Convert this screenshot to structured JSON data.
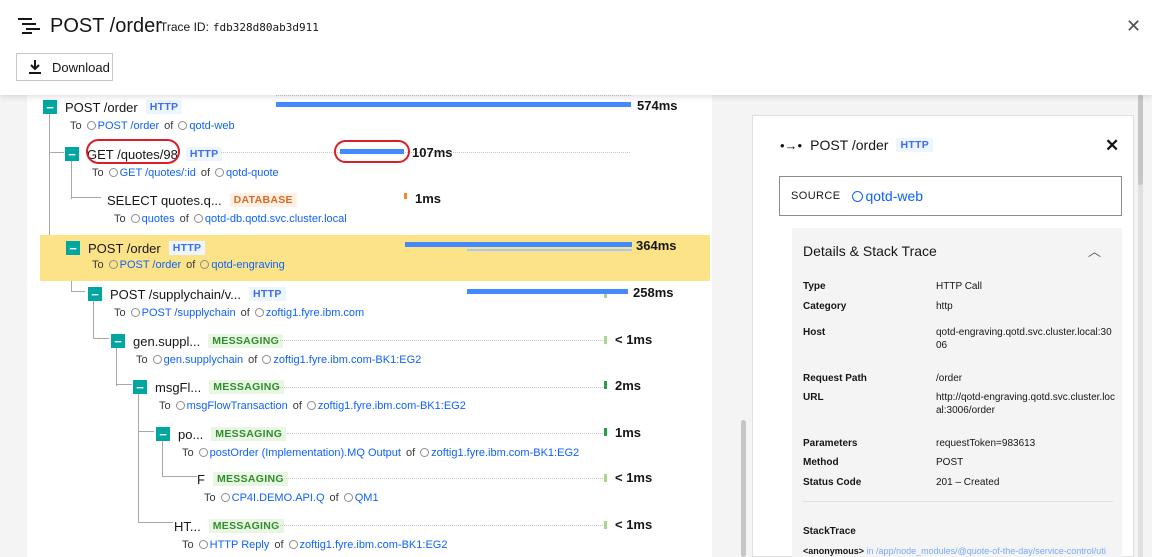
{
  "header": {
    "title": "POST /order",
    "trace_label": "Trace ID:",
    "trace_id": "fdb328d80ab3d911",
    "download_label": "Download"
  },
  "spans": [
    {
      "name": "POST /order",
      "badge": "HTTP",
      "to_label": "To",
      "endpoint": "POST /order",
      "of_label": "of",
      "service": "qotd-web",
      "duration": "574ms"
    },
    {
      "name": "GET /quotes/98",
      "badge": "HTTP",
      "to_label": "To",
      "endpoint": "GET /quotes/:id",
      "of_label": "of",
      "service": "qotd-quote",
      "duration": "107ms"
    },
    {
      "name": "SELECT quotes.q...",
      "badge": "DATABASE",
      "to_label": "To",
      "endpoint": "quotes",
      "of_label": "of",
      "service": "qotd-db.qotd.svc.cluster.local",
      "duration": "1ms"
    },
    {
      "name": "POST /order",
      "badge": "HTTP",
      "to_label": "To",
      "endpoint": "POST /order",
      "of_label": "of",
      "service": "qotd-engraving",
      "duration": "364ms"
    },
    {
      "name": "POST /supplychain/v...",
      "badge": "HTTP",
      "to_label": "To",
      "endpoint": "POST /supplychain",
      "of_label": "of",
      "service": "zoftig1.fyre.ibm.com",
      "duration": "258ms"
    },
    {
      "name": "gen.suppl...",
      "badge": "MESSAGING",
      "to_label": "To",
      "endpoint": "gen.supplychain",
      "of_label": "of",
      "service": "zoftig1.fyre.ibm.com-BK1:EG2",
      "duration": "< 1ms"
    },
    {
      "name": "msgFl...",
      "badge": "MESSAGING",
      "to_label": "To",
      "endpoint": "msgFlowTransaction",
      "of_label": "of",
      "service": "zoftig1.fyre.ibm.com-BK1:EG2",
      "duration": "2ms"
    },
    {
      "name": "po...",
      "badge": "MESSAGING",
      "to_label": "To",
      "endpoint": "postOrder (Implementation).MQ Output",
      "of_label": "of",
      "service": "zoftig1.fyre.ibm.com-BK1:EG2",
      "duration": "1ms"
    },
    {
      "name": "F",
      "badge": "MESSAGING",
      "to_label": "To",
      "endpoint": "CP4I.DEMO.API.Q",
      "of_label": "of",
      "service": "QM1",
      "duration": "< 1ms"
    },
    {
      "name": "HT...",
      "badge": "MESSAGING",
      "to_label": "To",
      "endpoint": "HTTP Reply",
      "of_label": "of",
      "service": "zoftig1.fyre.ibm.com-BK1:EG2",
      "duration": "< 1ms"
    }
  ],
  "detail": {
    "title": "POST /order",
    "badge": "HTTP",
    "source_label": "SOURCE",
    "source_value": "qotd-web",
    "section_title": "Details & Stack Trace",
    "fields": [
      {
        "key": "Type",
        "value": "HTTP Call"
      },
      {
        "key": "Category",
        "value": "http"
      },
      {
        "key": "Host",
        "value": "qotd-engraving.qotd.svc.cluster.local:3006"
      },
      {
        "key": "Request Path",
        "value": "/order"
      },
      {
        "key": "URL",
        "value": "http://qotd-engraving.qotd.svc.cluster.local:3006/order"
      },
      {
        "key": "Parameters",
        "value": "requestToken=983613"
      },
      {
        "key": "Method",
        "value": "POST"
      },
      {
        "key": "Status Code",
        "value": "201 – Created"
      }
    ],
    "stacktrace_label": "StackTrace",
    "stacktrace_fn": "<anonymous>",
    "stacktrace_path": "in /app/node_modules/@quote-of-the-day/service-control/uti"
  },
  "colors": {
    "accent": "#00a6a0",
    "highlight": "#fce388",
    "bar": "#4589ff",
    "link": "#0f62fe",
    "annotation": "#da1e28"
  }
}
